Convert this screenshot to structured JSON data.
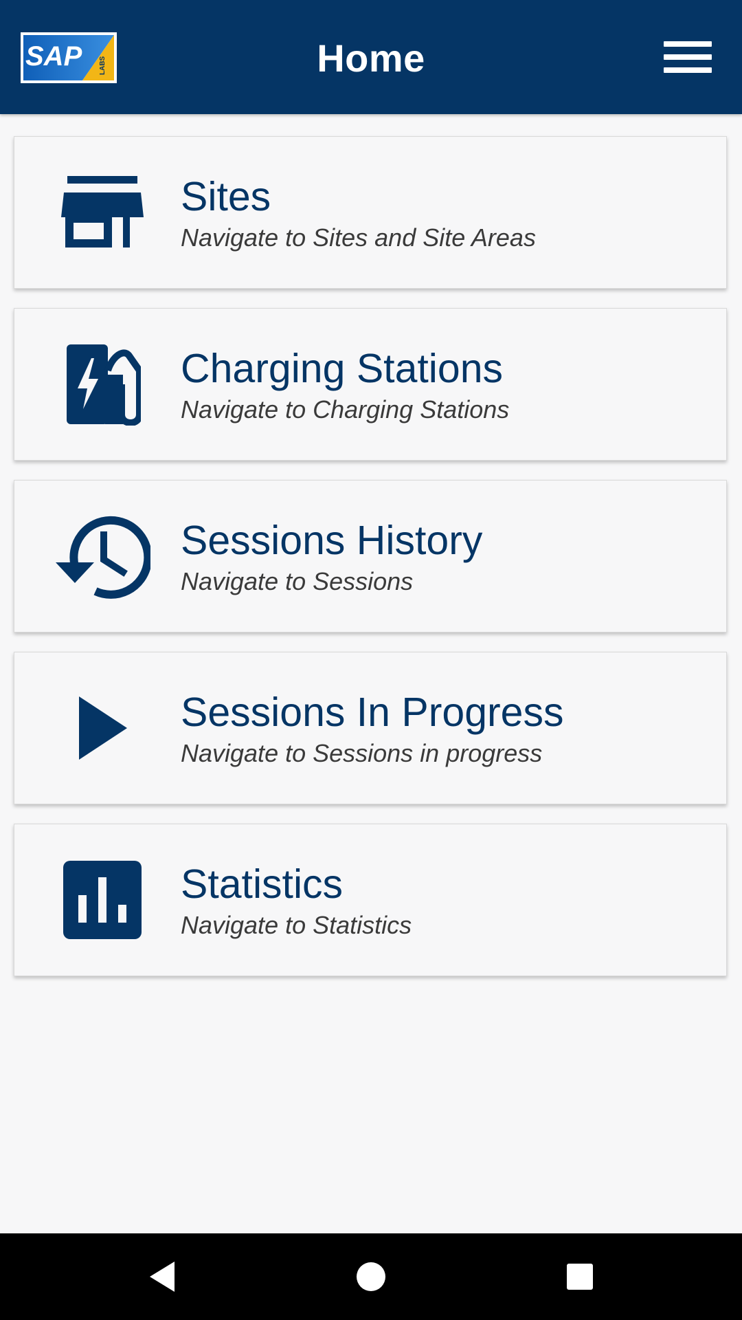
{
  "header": {
    "title": "Home",
    "logo": {
      "name": "sap-labs-logo",
      "text": "SAP",
      "subtext": "LABS"
    },
    "menu_icon": "hamburger-menu-icon"
  },
  "cards": [
    {
      "id": "sites",
      "title": "Sites",
      "subtitle": "Navigate to Sites and Site Areas",
      "icon": "store-icon"
    },
    {
      "id": "charging-stations",
      "title": "Charging Stations",
      "subtitle": "Navigate to Charging Stations",
      "icon": "ev-station-icon"
    },
    {
      "id": "sessions-history",
      "title": "Sessions History",
      "subtitle": "Navigate to Sessions",
      "icon": "history-icon"
    },
    {
      "id": "sessions-in-progress",
      "title": "Sessions In Progress",
      "subtitle": "Navigate to Sessions in progress",
      "icon": "play-icon"
    },
    {
      "id": "statistics",
      "title": "Statistics",
      "subtitle": "Navigate to Statistics",
      "icon": "bar-chart-icon"
    }
  ],
  "nav_bar": {
    "back_icon": "back-triangle-icon",
    "home_icon": "home-circle-icon",
    "recents_icon": "recents-square-icon"
  },
  "colors": {
    "primary": "#053565",
    "background": "#f7f7f8",
    "subtitle": "#3a3a3a",
    "logo_blue": "#1a73c8",
    "logo_yellow": "#f2b616"
  }
}
